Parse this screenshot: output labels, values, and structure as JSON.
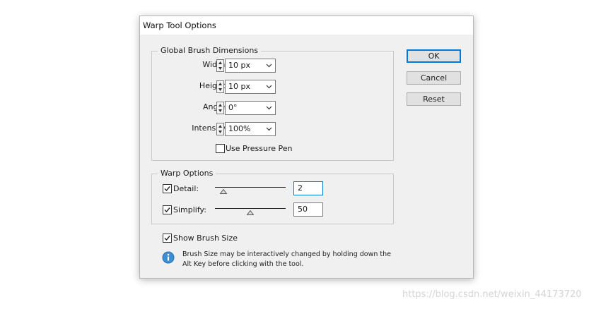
{
  "dialog": {
    "title": "Warp Tool Options",
    "buttons": {
      "ok": "OK",
      "cancel": "Cancel",
      "reset": "Reset"
    }
  },
  "global_brush": {
    "legend": "Global Brush Dimensions",
    "width": {
      "label": "Width:",
      "value": "10 px"
    },
    "height": {
      "label": "Height:",
      "value": "10 px"
    },
    "angle": {
      "label": "Angle:",
      "value": "0°"
    },
    "intensity": {
      "label": "Intensity:",
      "value": "100%"
    },
    "pressure": {
      "label": "Use Pressure Pen",
      "checked": false
    }
  },
  "warp_options": {
    "legend": "Warp Options",
    "detail": {
      "label": "Detail:",
      "value": "2",
      "checked": true,
      "slider_fraction": 0.12
    },
    "simplify": {
      "label": "Simplify:",
      "value": "50",
      "checked": true,
      "slider_fraction": 0.5
    }
  },
  "show_brush_size": {
    "label": "Show Brush Size",
    "checked": true
  },
  "info": {
    "text": "Brush Size may be interactively changed by holding down the Alt Key before clicking with the tool."
  },
  "watermark": "https://blog.csdn.net/weixin_44173720",
  "colors": {
    "focus": "#0078d7",
    "dialog_bg": "#f0f0f0",
    "info_icon": "#3b8fd4"
  }
}
